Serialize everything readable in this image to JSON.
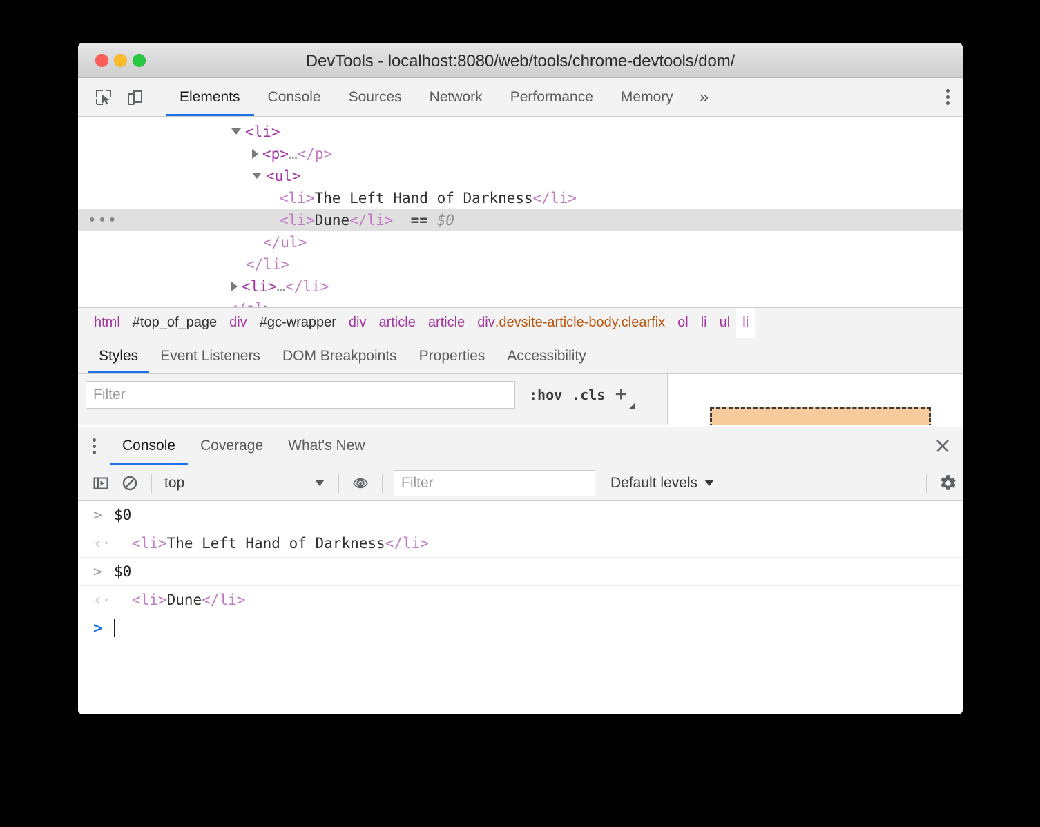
{
  "window": {
    "title": "DevTools - localhost:8080/web/tools/chrome-devtools/dom/",
    "traffic_lights": [
      "close-button",
      "minimize-button",
      "zoom-button"
    ],
    "colors": {
      "close": "#fc5f57",
      "minimize": "#fdbc2e",
      "zoom": "#28c841",
      "accent": "#1a73e8"
    }
  },
  "devtools_toolbar": {
    "inspect_icon": "inspect-element-icon",
    "device_icon": "device-toolbar-icon",
    "tabs": [
      {
        "label": "Elements",
        "active": true
      },
      {
        "label": "Console",
        "active": false
      },
      {
        "label": "Sources",
        "active": false
      },
      {
        "label": "Network",
        "active": false
      },
      {
        "label": "Performance",
        "active": false
      },
      {
        "label": "Memory",
        "active": false
      }
    ],
    "more_tabs_label": "»",
    "main_menu_icon": "kebab-menu-icon"
  },
  "dom_tree": {
    "rows": [
      {
        "indent": 222,
        "twisty": "open",
        "selected": false,
        "parts": [
          {
            "t": "tag",
            "v": "<li>"
          }
        ]
      },
      {
        "indent": 252,
        "twisty": "closed",
        "selected": false,
        "parts": [
          {
            "t": "tag",
            "v": "<p>"
          },
          {
            "t": "dots",
            "v": "…"
          },
          {
            "t": "tagc",
            "v": "</p>"
          }
        ]
      },
      {
        "indent": 252,
        "twisty": "open",
        "selected": false,
        "parts": [
          {
            "t": "tag",
            "v": "<ul>"
          }
        ]
      },
      {
        "indent": 292,
        "twisty": "none",
        "selected": false,
        "parts": [
          {
            "t": "tagc",
            "v": "<li>"
          },
          {
            "t": "txt",
            "v": "The Left Hand of Darkness"
          },
          {
            "t": "tagc",
            "v": "</li>"
          }
        ]
      },
      {
        "indent": 292,
        "twisty": "none",
        "selected": true,
        "ellipsis": "…",
        "parts": [
          {
            "t": "tagc",
            "v": "<li>"
          },
          {
            "t": "txt",
            "v": "Dune"
          },
          {
            "t": "tagc",
            "v": "</li>"
          },
          {
            "t": "eq",
            "v": "  =="
          },
          {
            "t": "dollar",
            "v": " $0"
          }
        ]
      },
      {
        "indent": 268,
        "twisty": "none",
        "selected": false,
        "parts": [
          {
            "t": "tagc",
            "v": "</ul>"
          }
        ]
      },
      {
        "indent": 243,
        "twisty": "none",
        "selected": false,
        "parts": [
          {
            "t": "tagc",
            "v": "</li>"
          }
        ]
      },
      {
        "indent": 222,
        "twisty": "closed",
        "selected": false,
        "parts": [
          {
            "t": "tag",
            "v": "<li>"
          },
          {
            "t": "dots",
            "v": "…"
          },
          {
            "t": "tagc",
            "v": "</li>"
          }
        ]
      },
      {
        "indent": 218,
        "twisty": "none",
        "selected": false,
        "parts": [
          {
            "t": "tagc",
            "v": "</ol>"
          }
        ]
      }
    ]
  },
  "breadcrumb": {
    "items": [
      {
        "tag": "html",
        "id": "",
        "cls": "",
        "selected": false
      },
      {
        "tag": "",
        "id": "#top_of_page",
        "cls": "",
        "selected": false
      },
      {
        "tag": "div",
        "id": "",
        "cls": "",
        "selected": false
      },
      {
        "tag": "",
        "id": "#gc-wrapper",
        "cls": "",
        "selected": false
      },
      {
        "tag": "div",
        "id": "",
        "cls": "",
        "selected": false
      },
      {
        "tag": "article",
        "id": "",
        "cls": "",
        "selected": false
      },
      {
        "tag": "article",
        "id": "",
        "cls": "",
        "selected": false
      },
      {
        "tag": "div",
        "id": "",
        "cls": ".devsite-article-body.clearfix",
        "selected": false
      },
      {
        "tag": "ol",
        "id": "",
        "cls": "",
        "selected": false
      },
      {
        "tag": "li",
        "id": "",
        "cls": "",
        "selected": false
      },
      {
        "tag": "ul",
        "id": "",
        "cls": "",
        "selected": false
      },
      {
        "tag": "li",
        "id": "",
        "cls": "",
        "selected": true
      }
    ]
  },
  "styles_pane": {
    "tabs": [
      {
        "label": "Styles",
        "active": true
      },
      {
        "label": "Event Listeners",
        "active": false
      },
      {
        "label": "DOM Breakpoints",
        "active": false
      },
      {
        "label": "Properties",
        "active": false
      },
      {
        "label": "Accessibility",
        "active": false
      }
    ],
    "filter_placeholder": "Filter",
    "filter_value": "",
    "hov_label": ":hov",
    "cls_label": ".cls",
    "new_rule_label": "+",
    "box_model_margin_color": "#f8cb9c"
  },
  "drawer": {
    "menu_icon": "kebab-menu-icon",
    "tabs": [
      {
        "label": "Console",
        "active": true
      },
      {
        "label": "Coverage",
        "active": false
      },
      {
        "label": "What's New",
        "active": false
      }
    ],
    "close_icon": "close-icon"
  },
  "console_toolbar": {
    "sidebar_icon": "console-sidebar-icon",
    "clear_icon": "clear-console-icon",
    "context": "top",
    "eye_icon": "live-expression-eye-icon",
    "filter_placeholder": "Filter",
    "filter_value": "",
    "levels_label": "Default levels",
    "settings_icon": "settings-gear-icon"
  },
  "console_log": {
    "entries": [
      {
        "kind": "input",
        "marker": ">",
        "parts": [
          {
            "t": "expr",
            "v": "$0"
          }
        ]
      },
      {
        "kind": "output",
        "marker": "‹·",
        "parts": [
          {
            "t": "tagc",
            "v": "<li>"
          },
          {
            "t": "txt",
            "v": "The Left Hand of Darkness"
          },
          {
            "t": "tagc",
            "v": "</li>"
          }
        ]
      },
      {
        "kind": "input",
        "marker": ">",
        "parts": [
          {
            "t": "expr",
            "v": "$0"
          }
        ]
      },
      {
        "kind": "output",
        "marker": "‹·",
        "parts": [
          {
            "t": "tagc",
            "v": "<li>"
          },
          {
            "t": "txt",
            "v": "Dune"
          },
          {
            "t": "tagc",
            "v": "</li>"
          }
        ]
      },
      {
        "kind": "prompt",
        "marker": ">",
        "parts": []
      }
    ]
  }
}
